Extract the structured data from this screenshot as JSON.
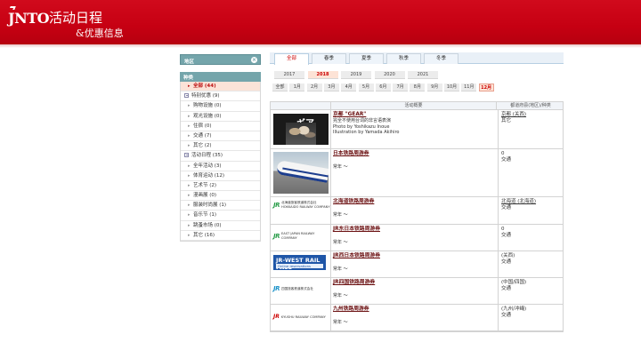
{
  "header": {
    "logo": "JNTO",
    "title": "活动日程",
    "subtitle": "&优惠信息"
  },
  "sidebar": {
    "region_label": "地区",
    "category_label": "种类",
    "items": [
      {
        "label": "全部 (44)",
        "type": "item",
        "active": true
      },
      {
        "label": "特别优惠 (9)",
        "type": "group"
      },
      {
        "label": "购物设施 (0)",
        "type": "item"
      },
      {
        "label": "观光设施 (0)",
        "type": "item"
      },
      {
        "label": "住宿 (0)",
        "type": "item"
      },
      {
        "label": "交通 (7)",
        "type": "item"
      },
      {
        "label": "其它 (2)",
        "type": "item"
      },
      {
        "label": "活动日程 (35)",
        "type": "group"
      },
      {
        "label": "全年活动 (3)",
        "type": "item"
      },
      {
        "label": "体育运动 (12)",
        "type": "item"
      },
      {
        "label": "艺术节 (2)",
        "type": "item"
      },
      {
        "label": "漫画展 (0)",
        "type": "item"
      },
      {
        "label": "服装时尚展 (1)",
        "type": "item"
      },
      {
        "label": "音乐节 (1)",
        "type": "item"
      },
      {
        "label": "跳蚤市场 (0)",
        "type": "item"
      },
      {
        "label": "其它 (16)",
        "type": "item"
      }
    ]
  },
  "seasons": [
    "全部",
    "春季",
    "夏季",
    "秋季",
    "冬季"
  ],
  "active_season": "全部",
  "years": [
    "2017",
    "2018",
    "2019",
    "2020",
    "2021"
  ],
  "active_year": "2018",
  "months": [
    "全部",
    "1月",
    "2月",
    "3月",
    "4月",
    "5月",
    "6月",
    "7月",
    "8月",
    "9月",
    "10月",
    "11月",
    "12月"
  ],
  "active_month": "12月",
  "table": {
    "col_summary": "活动概要",
    "col_region": "都道府县(地区)/种类",
    "rows": [
      {
        "title": "京都 \"GEAR\"",
        "desc": [
          "完全不使用台词的非言语表演",
          "Photo by Yoshikazu Inoue",
          "Illustration by Yamada Akihiro"
        ],
        "period": "",
        "region": "京都 (关西)",
        "category": "其它",
        "thumb": "gear-poster"
      },
      {
        "title": "日本铁路周游券",
        "desc": [],
        "period": "常年 ～",
        "region": "0",
        "category": "交通",
        "thumb": "shinkansen-photo"
      },
      {
        "title": "北海道铁路周游券",
        "desc": [],
        "period": "常年 ～",
        "region": "北海道 (北海道)",
        "category": "交通",
        "thumb": "jr-hokkaido-logo"
      },
      {
        "title": "JR东日本铁路周游券",
        "desc": [],
        "period": "常年 ～",
        "region": "0",
        "category": "交通",
        "thumb": "jr-east-logo"
      },
      {
        "title": "JR西日本铁路周游券",
        "desc": [],
        "period": "常年 ～",
        "region": "(关西)",
        "category": "交通",
        "thumb": "jr-west-rail-pass"
      },
      {
        "title": "JR四国铁路周游券",
        "desc": [],
        "period": "常年 ～",
        "region": "(中国/四国)",
        "category": "交通",
        "thumb": "jr-shikoku-logo"
      },
      {
        "title": "九州铁路周游券",
        "desc": [],
        "period": "常年 ～",
        "region": "(九州/冲绳)",
        "category": "交通",
        "thumb": "jr-kyushu-logo"
      }
    ]
  },
  "logos": {
    "jr_hokkaido_text": "北海道旅客鉄道株式会社",
    "jr_hokkaido_en": "HOKKAIDO RAILWAY COMPANY",
    "jr_east_en": "EAST JAPAN RAILWAY COMPANY",
    "jr_west_pass": "JR-WEST RAIL PASS",
    "jr_west_sub": "Online reservations",
    "jr_shikoku_text": "四国旅客鉄道株式会社",
    "jr_kyushu_en": "KYUSHU RAILWAY COMPANY",
    "jr_mark": "JR",
    "gear_title": "ギア"
  },
  "colors": {
    "header_red": "#c60012",
    "sidebar_teal": "#74a5ab",
    "link_dark_red": "#6a0f10",
    "active_peach": "#fde3d6"
  }
}
